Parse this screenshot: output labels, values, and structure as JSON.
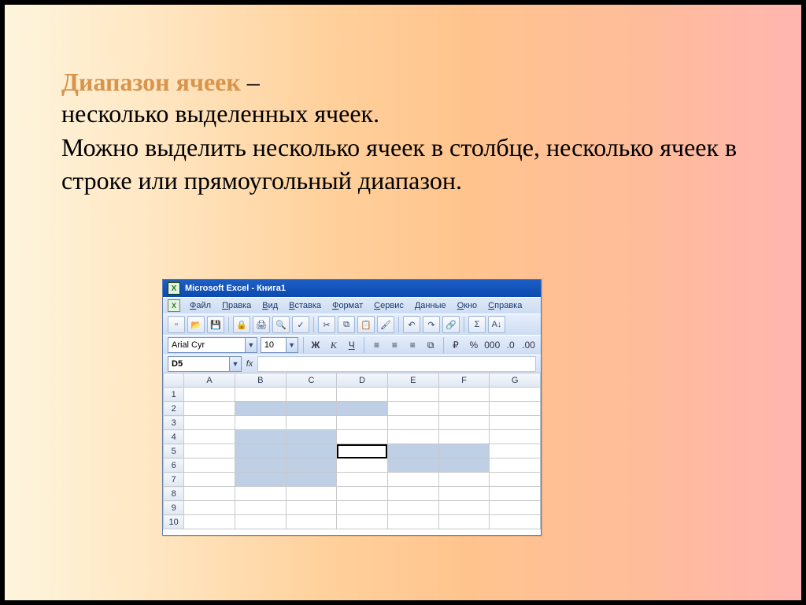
{
  "slide": {
    "title_accent": "Диапазон ячеек",
    "title_dash": " –",
    "line1": "несколько выделенных ячеек.",
    "body": "Можно выделить несколько ячеек в столбце, несколько ячеек в строке или прямоугольный диапазон."
  },
  "excel": {
    "app_icon_letter": "X",
    "window_title": "Microsoft Excel - Книга1",
    "menu": [
      "Файл",
      "Правка",
      "Вид",
      "Вставка",
      "Формат",
      "Сервис",
      "Данные",
      "Окно",
      "Справка"
    ],
    "toolbar_icons": [
      "new",
      "open",
      "save",
      "perm",
      "print",
      "preview",
      "spell",
      "cut",
      "copy",
      "paste",
      "fmtpaint",
      "undo",
      "redo",
      "link",
      "sum",
      "sort-asc"
    ],
    "font_name": "Arial Cyr",
    "font_size": "10",
    "format_buttons": [
      "Ж",
      "К",
      "Ч"
    ],
    "align_icons": [
      "left",
      "center",
      "right",
      "merge"
    ],
    "number_icons": [
      "currency",
      "percent",
      "thousands",
      "inc-dec",
      "dec-dec"
    ],
    "name_box": "D5",
    "fx_label": "fx",
    "columns": [
      "A",
      "B",
      "C",
      "D",
      "E",
      "F",
      "G"
    ],
    "rows": [
      "1",
      "2",
      "3",
      "4",
      "5",
      "6",
      "7",
      "8",
      "9",
      "10"
    ],
    "selected_col_headers": [
      "B",
      "C",
      "D",
      "E",
      "F"
    ],
    "selected_row_headers": [
      "2",
      "4",
      "5",
      "6",
      "7"
    ],
    "highlight_cells": [
      "B2",
      "C2",
      "D2",
      "B4",
      "C4",
      "B5",
      "C5",
      "E5",
      "F5",
      "B6",
      "C6",
      "E6",
      "F6",
      "B7",
      "C7"
    ],
    "active_cell": "D5"
  }
}
